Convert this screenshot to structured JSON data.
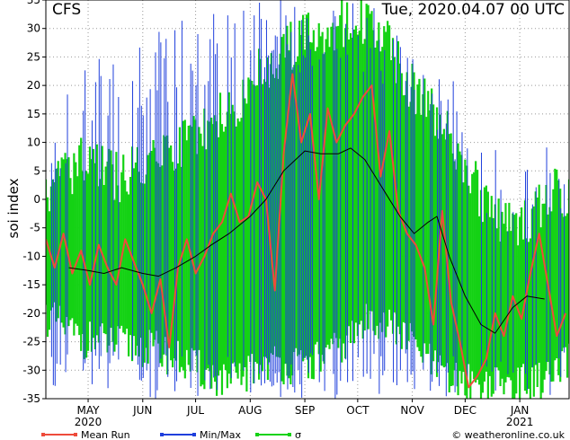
{
  "header": {
    "model": "CFS",
    "run_time": "Tue, 2020.04.07   00 UTC"
  },
  "footer": {
    "credit": "© weatheronline.co.uk"
  },
  "colors": {
    "mean": "#ee4b3b",
    "minmax": "#1f3fdc",
    "sigma": "#14d214",
    "smooth": "#000000",
    "grid": "#999999"
  },
  "chart_data": {
    "type": "line",
    "ylabel": "soi index",
    "ylim": [
      -35,
      35
    ],
    "yticks": [
      -35,
      -30,
      -25,
      -20,
      -15,
      -10,
      -5,
      0,
      5,
      10,
      15,
      20,
      25,
      30,
      35
    ],
    "x_start": "2020-04-07",
    "x_end": "2021-01-29",
    "month_ticks": [
      {
        "label": "MAY",
        "date": "2020-05-01",
        "year": "2020"
      },
      {
        "label": "JUN",
        "date": "2020-06-01",
        "year": ""
      },
      {
        "label": "JUL",
        "date": "2020-07-01",
        "year": ""
      },
      {
        "label": "AUG",
        "date": "2020-08-01",
        "year": ""
      },
      {
        "label": "SEP",
        "date": "2020-09-01",
        "year": ""
      },
      {
        "label": "OCT",
        "date": "2020-10-01",
        "year": ""
      },
      {
        "label": "NOV",
        "date": "2020-11-01",
        "year": ""
      },
      {
        "label": "DEC",
        "date": "2020-12-01",
        "year": ""
      },
      {
        "label": "JAN",
        "date": "2021-01-01",
        "year": "2021"
      }
    ],
    "legend": [
      {
        "name": "Mean Run",
        "key": "mean"
      },
      {
        "name": "Min/Max",
        "key": "minmax"
      },
      {
        "name": "σ",
        "key": "sigma"
      }
    ],
    "series": [
      {
        "name": "Mean Run",
        "points": [
          [
            "2020-04-07",
            -7
          ],
          [
            "2020-04-12",
            -12
          ],
          [
            "2020-04-17",
            -6
          ],
          [
            "2020-04-22",
            -13
          ],
          [
            "2020-04-27",
            -9
          ],
          [
            "2020-05-02",
            -15
          ],
          [
            "2020-05-07",
            -8
          ],
          [
            "2020-05-12",
            -12
          ],
          [
            "2020-05-17",
            -15
          ],
          [
            "2020-05-22",
            -7
          ],
          [
            "2020-05-27",
            -11
          ],
          [
            "2020-06-01",
            -15
          ],
          [
            "2020-06-06",
            -20
          ],
          [
            "2020-06-11",
            -14
          ],
          [
            "2020-06-16",
            -26
          ],
          [
            "2020-06-21",
            -12
          ],
          [
            "2020-06-26",
            -7
          ],
          [
            "2020-07-01",
            -13
          ],
          [
            "2020-07-06",
            -10
          ],
          [
            "2020-07-11",
            -6
          ],
          [
            "2020-07-16",
            -4
          ],
          [
            "2020-07-21",
            1
          ],
          [
            "2020-07-26",
            -4
          ],
          [
            "2020-07-31",
            -3
          ],
          [
            "2020-08-05",
            3
          ],
          [
            "2020-08-10",
            0
          ],
          [
            "2020-08-15",
            -16
          ],
          [
            "2020-08-20",
            8
          ],
          [
            "2020-08-25",
            22
          ],
          [
            "2020-08-30",
            10
          ],
          [
            "2020-09-04",
            15
          ],
          [
            "2020-09-09",
            0
          ],
          [
            "2020-09-14",
            16
          ],
          [
            "2020-09-19",
            10
          ],
          [
            "2020-09-24",
            13
          ],
          [
            "2020-09-29",
            15
          ],
          [
            "2020-10-04",
            18
          ],
          [
            "2020-10-09",
            20
          ],
          [
            "2020-10-14",
            4
          ],
          [
            "2020-10-19",
            12
          ],
          [
            "2020-10-24",
            -2
          ],
          [
            "2020-10-29",
            -6
          ],
          [
            "2020-11-03",
            -8
          ],
          [
            "2020-11-08",
            -12
          ],
          [
            "2020-11-13",
            -22
          ],
          [
            "2020-11-18",
            -2
          ],
          [
            "2020-11-23",
            -18
          ],
          [
            "2020-11-28",
            -25
          ],
          [
            "2020-12-03",
            -33
          ],
          [
            "2020-12-08",
            -31
          ],
          [
            "2020-12-13",
            -28
          ],
          [
            "2020-12-18",
            -20
          ],
          [
            "2020-12-23",
            -24
          ],
          [
            "2020-12-28",
            -17
          ],
          [
            "2021-01-02",
            -21
          ],
          [
            "2021-01-07",
            -13
          ],
          [
            "2021-01-12",
            -6
          ],
          [
            "2021-01-17",
            -15
          ],
          [
            "2021-01-22",
            -24
          ],
          [
            "2021-01-27",
            -20
          ]
        ]
      },
      {
        "name": "Smoothed",
        "points": [
          [
            "2020-04-20",
            -12
          ],
          [
            "2020-05-01",
            -12.5
          ],
          [
            "2020-05-10",
            -13
          ],
          [
            "2020-05-20",
            -12
          ],
          [
            "2020-06-01",
            -13
          ],
          [
            "2020-06-10",
            -13.5
          ],
          [
            "2020-06-20",
            -12
          ],
          [
            "2020-07-01",
            -10
          ],
          [
            "2020-07-10",
            -8
          ],
          [
            "2020-07-20",
            -6
          ],
          [
            "2020-08-01",
            -3
          ],
          [
            "2020-08-10",
            0
          ],
          [
            "2020-08-20",
            5
          ],
          [
            "2020-09-01",
            8.5
          ],
          [
            "2020-09-10",
            8
          ],
          [
            "2020-09-20",
            8
          ],
          [
            "2020-09-27",
            9
          ],
          [
            "2020-10-05",
            7
          ],
          [
            "2020-10-15",
            2
          ],
          [
            "2020-10-25",
            -3
          ],
          [
            "2020-11-02",
            -6
          ],
          [
            "2020-11-10",
            -4
          ],
          [
            "2020-11-15",
            -3
          ],
          [
            "2020-11-22",
            -10
          ],
          [
            "2020-12-01",
            -17
          ],
          [
            "2020-12-10",
            -22
          ],
          [
            "2020-12-18",
            -23.5
          ],
          [
            "2020-12-28",
            -19
          ],
          [
            "2021-01-05",
            -17
          ],
          [
            "2021-01-15",
            -17.5
          ]
        ]
      }
    ],
    "sigma_envelope": [
      [
        "2020-04-07",
        -22,
        3
      ],
      [
        "2020-04-27",
        -26,
        8
      ],
      [
        "2020-05-20",
        -27,
        5
      ],
      [
        "2020-06-10",
        -28,
        10
      ],
      [
        "2020-06-30",
        -31,
        12
      ],
      [
        "2020-07-20",
        -34,
        17
      ],
      [
        "2020-08-10",
        -30,
        25
      ],
      [
        "2020-08-30",
        -31,
        30
      ],
      [
        "2020-09-20",
        -28,
        32
      ],
      [
        "2020-10-10",
        -22,
        33
      ],
      [
        "2020-10-30",
        -26,
        22
      ],
      [
        "2020-11-20",
        -33,
        15
      ],
      [
        "2020-12-10",
        -34,
        2
      ],
      [
        "2020-12-30",
        -34,
        -5
      ],
      [
        "2021-01-20",
        -33,
        4
      ],
      [
        "2021-01-29",
        -30,
        2
      ]
    ],
    "minmax_envelope": [
      [
        "2020-04-07",
        -34,
        12
      ],
      [
        "2020-04-27",
        -35,
        25
      ],
      [
        "2020-05-20",
        -35,
        25
      ],
      [
        "2020-06-10",
        -35,
        30
      ],
      [
        "2020-06-30",
        -35,
        33
      ],
      [
        "2020-07-20",
        -35,
        35
      ],
      [
        "2020-08-10",
        -35,
        35
      ],
      [
        "2020-08-30",
        -35,
        35
      ],
      [
        "2020-09-20",
        -35,
        35
      ],
      [
        "2020-10-10",
        -34,
        35
      ],
      [
        "2020-10-30",
        -35,
        30
      ],
      [
        "2020-11-20",
        -35,
        23
      ],
      [
        "2020-12-10",
        -35,
        12
      ],
      [
        "2020-12-30",
        -35,
        5
      ],
      [
        "2021-01-20",
        -35,
        11
      ],
      [
        "2021-01-29",
        -34,
        10
      ]
    ]
  }
}
